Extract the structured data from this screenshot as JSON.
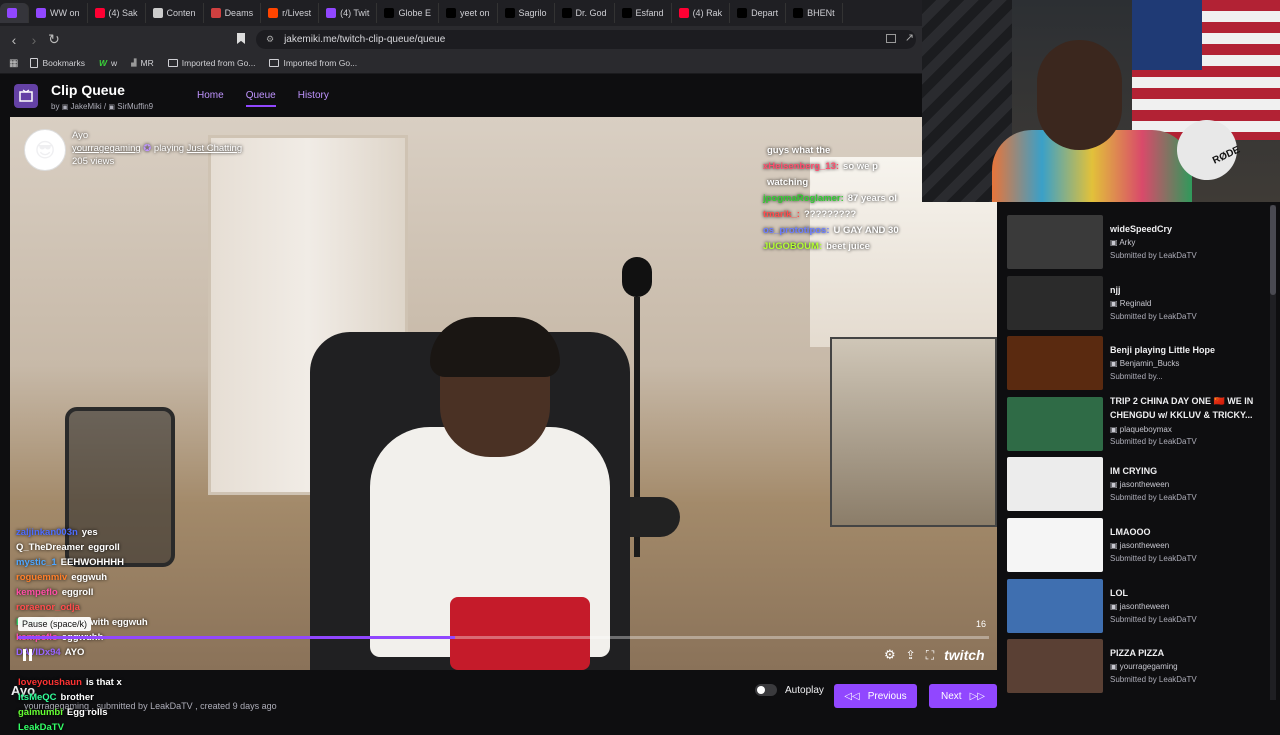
{
  "browser": {
    "tabs": [
      {
        "label": "",
        "color": "#9147ff"
      },
      {
        "label": "WW on",
        "color": "#9147ff"
      },
      {
        "label": "(4) Sak",
        "color": "#ff0033"
      },
      {
        "label": "Conten",
        "color": "#cccccc"
      },
      {
        "label": "Deams",
        "color": "#d04040"
      },
      {
        "label": "r/Livest",
        "color": "#ff4500"
      },
      {
        "label": "(4) Twit",
        "color": "#9147ff"
      },
      {
        "label": "Globe E",
        "color": "#000000"
      },
      {
        "label": "yeet on",
        "color": "#000000"
      },
      {
        "label": "Sagrilo",
        "color": "#000000"
      },
      {
        "label": "Dr. God",
        "color": "#000000"
      },
      {
        "label": "Esfand",
        "color": "#000000"
      },
      {
        "label": "(4) Rak",
        "color": "#ff0033"
      },
      {
        "label": "Depart",
        "color": "#000000"
      },
      {
        "label": "BHENt",
        "color": "#000000"
      }
    ],
    "url": "jakemiki.me/twitch-clip-queue/queue",
    "bookmarks": [
      "Bookmarks",
      "w",
      "MR",
      "Imported from Go...",
      "Imported from Go..."
    ]
  },
  "app": {
    "title": "Clip Queue",
    "by_prefix": "by",
    "author1": "JakeMiki",
    "sep": "/",
    "author2": "SirMuffin9",
    "nav": [
      "Home",
      "Queue",
      "History"
    ]
  },
  "clip": {
    "title": "Ayo",
    "channel": "yourragegaming",
    "playing_word": "playing",
    "category": "Just Chatting",
    "views": "205 views",
    "timecode": "16",
    "progress": 0.45,
    "tooltip": "Pause (space/k)"
  },
  "chat_top": [
    {
      "user": "",
      "msg": "",
      "color": "#888"
    },
    {
      "user": "",
      "msg": "guys what the",
      "color": "#b0b0b0"
    },
    {
      "user": "xHeisenberg_13:",
      "msg": "so we p",
      "color": "#ff4d6d"
    },
    {
      "user": "",
      "msg": "watching",
      "color": "#fff"
    },
    {
      "user": "jpogmaRoglamer:",
      "msg": "87 years ol",
      "color": "#33cc33"
    },
    {
      "user": "tmarik_:",
      "msg": "?????????",
      "color": "#ff4d4d"
    },
    {
      "user": "os_prototipos:",
      "msg": "U GAY AND 30",
      "color": "#6c7dff"
    },
    {
      "user": "JUGOBOUM:",
      "msg": "beet juice",
      "color": "#b3ff33"
    }
  ],
  "chat_bottom": [
    {
      "user": "zaljinkan003n",
      "msg": "yes",
      "color": "#4d6dff"
    },
    {
      "user": "Q_TheDreamer",
      "msg": "eggroll",
      "color": "#ffffff"
    },
    {
      "user": "mystic_1",
      "msg": "EEHWOHHHH",
      "color": "#4da6ff"
    },
    {
      "user": "roguemmiv",
      "msg": "eggwuh",
      "color": "#ff7f2a"
    },
    {
      "user": "kempeflo",
      "msg": "eggroll",
      "color": "#ff4da6"
    },
    {
      "user": "roraenor_odja",
      "msg": "",
      "color": "#ff4d4d"
    },
    {
      "user": "BruHEz",
      "msg": "it come with eggwuh",
      "color": "#33cc66"
    },
    {
      "user": "kempeflo",
      "msg": "eggwuhh",
      "color": "#ff4da6"
    },
    {
      "user": "DAVIDx94",
      "msg": "AYO",
      "color": "#9966ff"
    }
  ],
  "chat_bottom2": [
    {
      "user": "loveyoushaun",
      "msg": "is that x",
      "color": "#ff3333"
    },
    {
      "user": "ItsMeQC",
      "msg": "brother",
      "color": "#33ff99"
    },
    {
      "user": "gaimumbi",
      "msg": "Egg rolls",
      "color": "#66ff33"
    },
    {
      "user": "LeakDaTV",
      "msg": "",
      "color": "#33ff66"
    }
  ],
  "webcam": {
    "mic_brand": "RØDE"
  },
  "queue": [
    {
      "title": "wideSpeedCry",
      "channel": "Arky",
      "submitted": "Submitted by LeakDaTV",
      "thumb": "#3a3a3a"
    },
    {
      "title": "njj",
      "channel": "Reginald",
      "submitted": "Submitted by LeakDaTV",
      "thumb": "#2b2b2b"
    },
    {
      "title": "Benji playing Little Hope",
      "channel": "Benjamin_Bucks",
      "submitted": "Submitted by...",
      "thumb": "#5a2a10"
    },
    {
      "title": "TRIP 2 CHINA DAY ONE 🇨🇳 WE IN CHENGDU w/ KKLUV & TRICKY...",
      "channel": "plaqueboymax",
      "submitted": "Submitted by LeakDaTV",
      "thumb": "#2f6b46"
    },
    {
      "title": "IM CRYING",
      "channel": "jasontheween",
      "submitted": "Submitted by LeakDaTV",
      "thumb": "#ececec"
    },
    {
      "title": "LMAOOO",
      "channel": "jasontheween",
      "submitted": "Submitted by LeakDaTV",
      "thumb": "#f5f5f5"
    },
    {
      "title": "LOL",
      "channel": "jasontheween",
      "submitted": "Submitted by LeakDaTV",
      "thumb": "#3f6fb0"
    },
    {
      "title": "PIZZA PIZZA",
      "channel": "yourragegaming",
      "submitted": "Submitted by LeakDaTV",
      "thumb": "#5a4034"
    }
  ],
  "footer": {
    "title": "Ayo",
    "meta": "yourragegaming , submitted by LeakDaTV , created 9 days ago",
    "autoplay": "Autoplay",
    "previous": "Previous",
    "next": "Next"
  },
  "colors": {
    "accent": "#9147ff",
    "bg": "#0e0e10"
  }
}
